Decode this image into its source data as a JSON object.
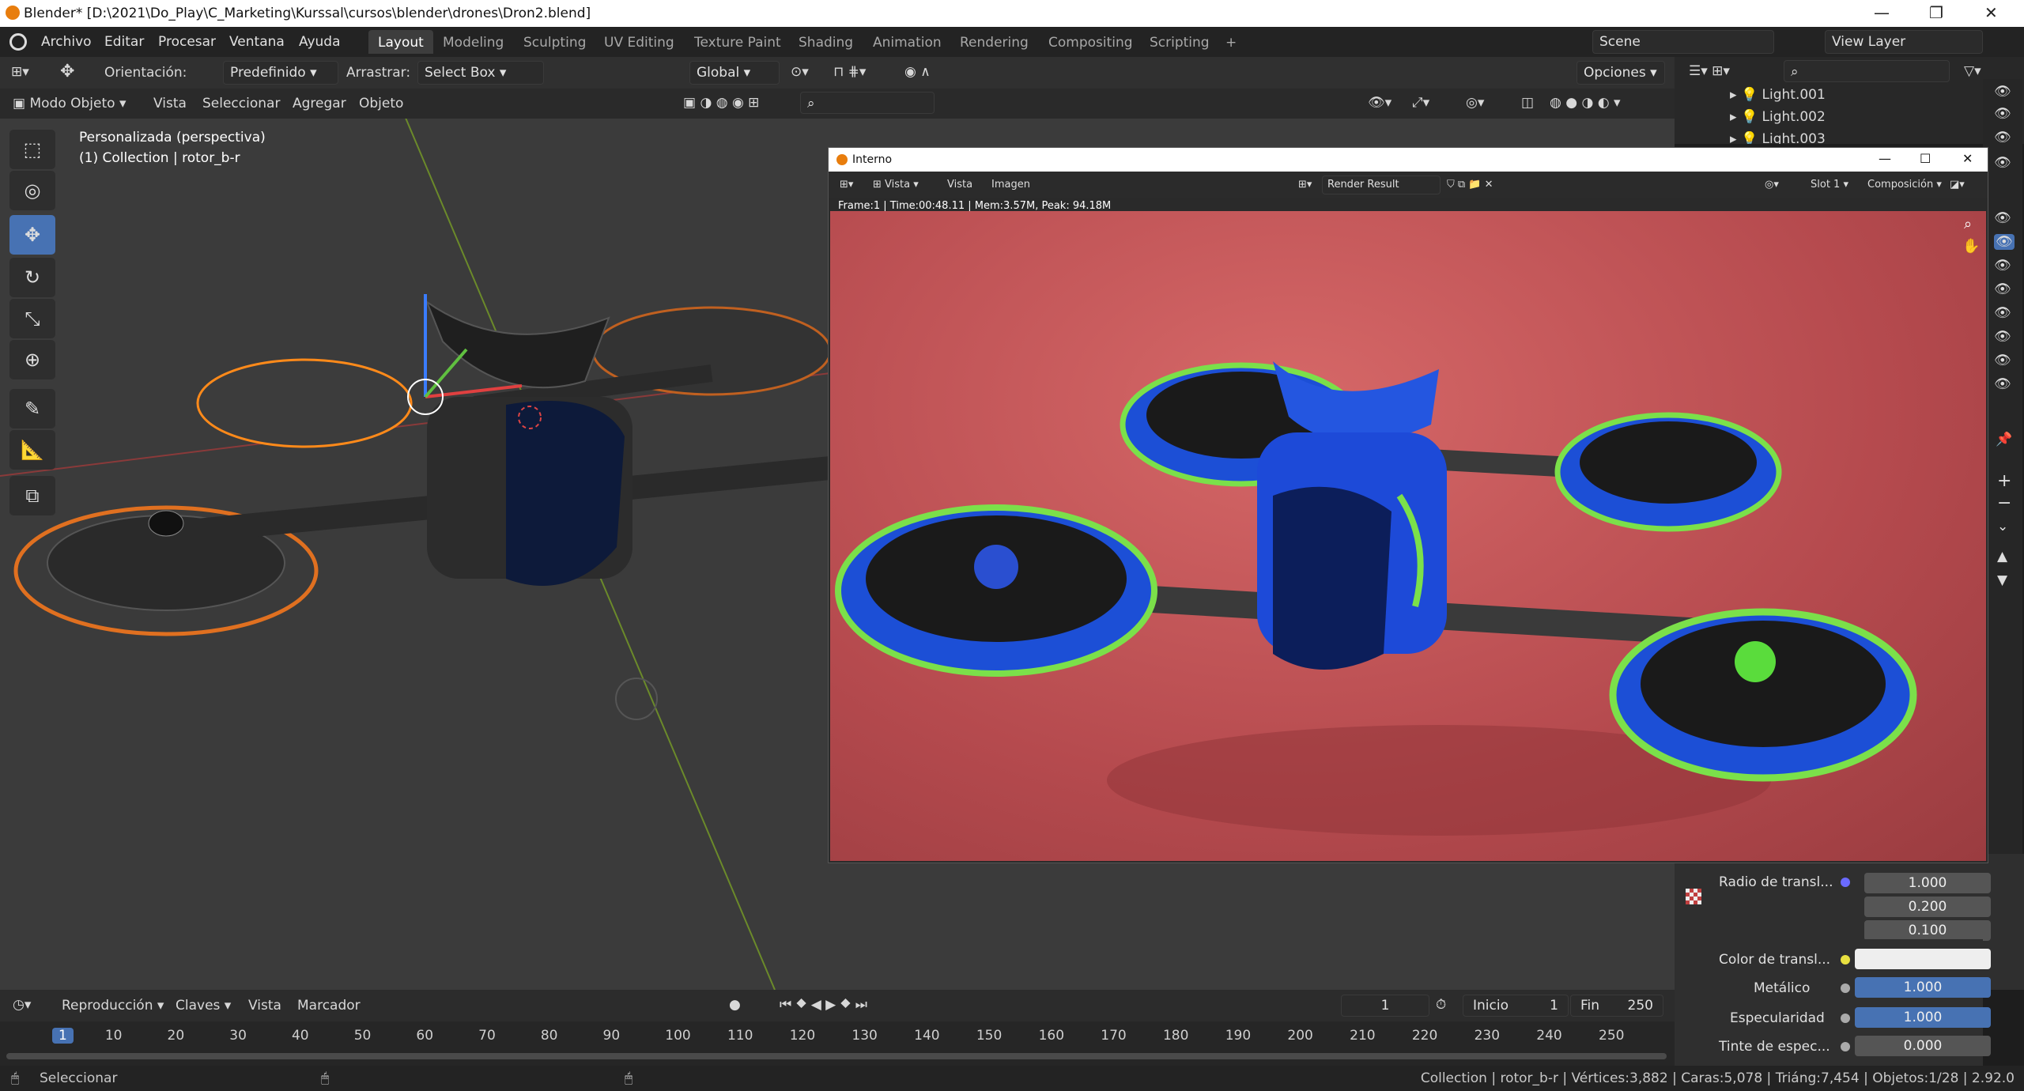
{
  "window": {
    "title": "Blender* [D:\\2021\\Do_Play\\C_Marketing\\Kurssal\\cursos\\blender\\drones\\Dron2.blend]"
  },
  "menu": [
    "Archivo",
    "Editar",
    "Procesar",
    "Ventana",
    "Ayuda"
  ],
  "workspaces": [
    "Layout",
    "Modeling",
    "Sculpting",
    "UV Editing",
    "Texture Paint",
    "Shading",
    "Animation",
    "Rendering",
    "Compositing",
    "Scripting"
  ],
  "active_workspace": "Layout",
  "scene": {
    "label": "Scene",
    "view_layer": "View Layer"
  },
  "header1": {
    "orientation_label": "Orientación:",
    "orientation_value": "Predefinido",
    "drag_label": "Arrastrar:",
    "drag_value": "Select Box",
    "transform": "Global",
    "options": "Opciones"
  },
  "header2": {
    "mode": "Modo Objeto",
    "items": [
      "Vista",
      "Seleccionar",
      "Agregar",
      "Objeto"
    ]
  },
  "viewport": {
    "overlay_view": "Personalizada (perspectiva)",
    "overlay_collection": "(1) Collection | rotor_b-r"
  },
  "outliner": {
    "items": [
      "Light.001",
      "Light.002",
      "Light.003"
    ]
  },
  "render_window": {
    "title": "Interno",
    "menus": [
      "Vista",
      "Vista",
      "Imagen"
    ],
    "image": "Render Result",
    "slot": "Slot 1",
    "pass": "Composición",
    "info": "Frame:1 | Time:00:48.11 | Mem:3.57M, Peak: 94.18M"
  },
  "properties": {
    "rows": [
      {
        "label": "Radio de transl...",
        "value": "1.000"
      },
      {
        "label": "",
        "value": "0.200"
      },
      {
        "label": "",
        "value": "0.100"
      },
      {
        "label": "Color de transl...",
        "value": ""
      },
      {
        "label": "Metálico",
        "value": "1.000"
      },
      {
        "label": "Especularidad",
        "value": "1.000"
      },
      {
        "label": "Tinte de espec...",
        "value": "0.000"
      }
    ]
  },
  "timeline": {
    "menus": [
      "Reproducción",
      "Claves",
      "Vista",
      "Marcador"
    ],
    "current_frame": "1",
    "start_label": "Inicio",
    "start": "1",
    "end_label": "Fin",
    "end": "250",
    "ticks": [
      "1",
      "10",
      "20",
      "30",
      "40",
      "50",
      "60",
      "70",
      "80",
      "90",
      "100",
      "110",
      "120",
      "130",
      "140",
      "150",
      "160",
      "170",
      "180",
      "190",
      "200",
      "210",
      "220",
      "230",
      "240",
      "250"
    ]
  },
  "status": {
    "left": "Seleccionar",
    "right": "Collection | rotor_b-r | Vértices:3,882 | Caras:5,078 | Triáng:7,454 | Objetos:1/28 | 2.92.0"
  }
}
